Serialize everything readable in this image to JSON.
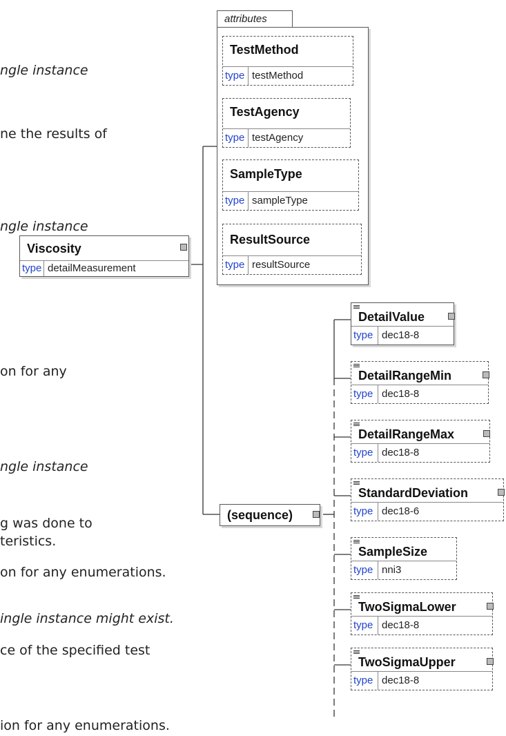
{
  "doc_text": [
    "ngle instance",
    "ne the results of",
    "ngle instance",
    "on for any",
    "ngle instance",
    "g was done to",
    "teristics.",
    "on for any enumerations.",
    "ingle instance might exist.",
    "ce of the specified test",
    "ion for any enumerations."
  ],
  "root": {
    "name": "Viscosity",
    "type_key": "type",
    "type": "detailMeasurement"
  },
  "attributes": {
    "title": "attributes",
    "items": [
      {
        "name": "TestMethod",
        "type_key": "type",
        "type": "testMethod"
      },
      {
        "name": "TestAgency",
        "type_key": "type",
        "type": "testAgency"
      },
      {
        "name": "SampleType",
        "type_key": "type",
        "type": "sampleType"
      },
      {
        "name": "ResultSource",
        "type_key": "type",
        "type": "resultSource"
      }
    ]
  },
  "sequence": {
    "label": "(sequence)"
  },
  "elements": [
    {
      "name": "DetailValue",
      "type_key": "type",
      "type": "dec18-8",
      "optional": false
    },
    {
      "name": "DetailRangeMin",
      "type_key": "type",
      "type": "dec18-8",
      "optional": true
    },
    {
      "name": "DetailRangeMax",
      "type_key": "type",
      "type": "dec18-8",
      "optional": true
    },
    {
      "name": "StandardDeviation",
      "type_key": "type",
      "type": "dec18-6",
      "optional": true
    },
    {
      "name": "SampleSize",
      "type_key": "type",
      "type": "nni3",
      "optional": true
    },
    {
      "name": "TwoSigmaLower",
      "type_key": "type",
      "type": "dec18-8",
      "optional": true
    },
    {
      "name": "TwoSigmaUpper",
      "type_key": "type",
      "type": "dec18-8",
      "optional": true
    }
  ]
}
